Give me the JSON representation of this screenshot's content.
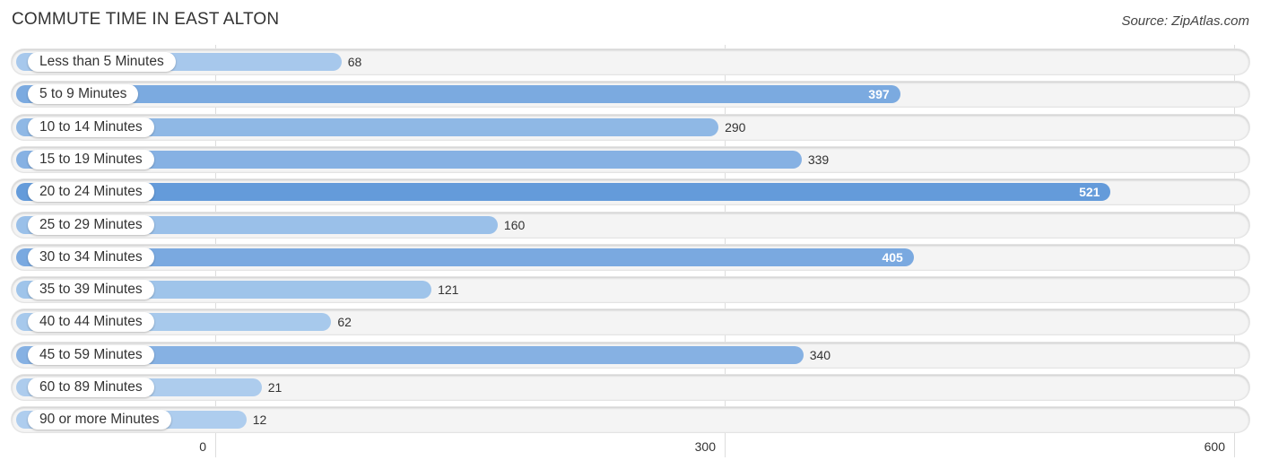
{
  "header": {
    "title": "COMMUTE TIME IN EAST ALTON",
    "source": "Source: ZipAtlas.com"
  },
  "colors": {
    "bar_light": "#a8c8ec",
    "bar_dark": "#6a9fdc",
    "row_bg": "#f4f4f4"
  },
  "chart_data": {
    "type": "bar",
    "orientation": "horizontal",
    "title": "COMMUTE TIME IN EAST ALTON",
    "xlabel": "",
    "ylabel": "",
    "xlim": [
      0,
      600
    ],
    "grid": true,
    "categories": [
      "Less than 5 Minutes",
      "5 to 9 Minutes",
      "10 to 14 Minutes",
      "15 to 19 Minutes",
      "20 to 24 Minutes",
      "25 to 29 Minutes",
      "30 to 34 Minutes",
      "35 to 39 Minutes",
      "40 to 44 Minutes",
      "45 to 59 Minutes",
      "60 to 89 Minutes",
      "90 or more Minutes"
    ],
    "values": [
      68,
      397,
      290,
      339,
      521,
      160,
      405,
      121,
      62,
      340,
      21,
      12
    ],
    "value_labels": [
      "68",
      "397",
      "290",
      "339",
      "521",
      "160",
      "405",
      "121",
      "62",
      "340",
      "21",
      "12"
    ],
    "x_ticks": [
      {
        "value": 0,
        "label": "0"
      },
      {
        "value": 300,
        "label": "300"
      },
      {
        "value": 600,
        "label": "600"
      }
    ]
  }
}
